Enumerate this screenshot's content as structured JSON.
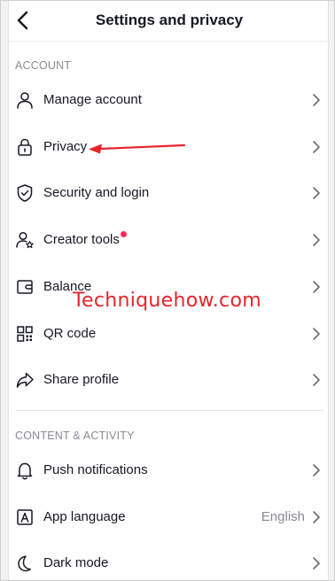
{
  "header": {
    "title": "Settings and privacy",
    "back_icon": "chevron-left-icon"
  },
  "sections": {
    "account": "ACCOUNT",
    "content": "CONTENT & ACTIVITY"
  },
  "items": {
    "manage_account": {
      "label": "Manage account",
      "icon": "person-icon"
    },
    "privacy": {
      "label": "Privacy",
      "icon": "lock-icon"
    },
    "security": {
      "label": "Security and login",
      "icon": "shield-check-icon"
    },
    "creator_tools": {
      "label": "Creator tools",
      "icon": "person-star-icon"
    },
    "balance": {
      "label": "Balance",
      "icon": "wallet-icon"
    },
    "qr_code": {
      "label": "QR code",
      "icon": "qr-code-icon"
    },
    "share_profile": {
      "label": "Share profile",
      "icon": "share-arrow-icon"
    },
    "push_notifications": {
      "label": "Push notifications",
      "icon": "bell-icon"
    },
    "app_language": {
      "label": "App language",
      "value": "English",
      "icon": "letter-a-icon"
    },
    "dark_mode": {
      "label": "Dark mode",
      "icon": "moon-icon"
    }
  },
  "watermark": "Techniquehow.com",
  "colors": {
    "accent_dot": "#fe2c55",
    "annotation_red": "#e8242b",
    "muted_text": "#8a8b91"
  }
}
